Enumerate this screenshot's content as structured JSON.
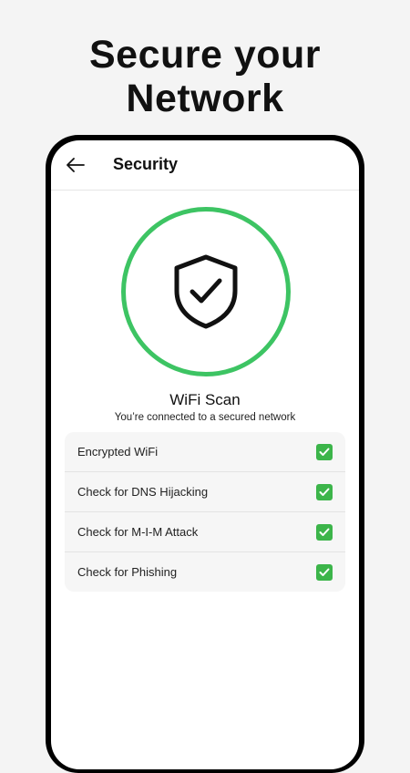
{
  "promo": {
    "title_line1": "Secure your",
    "title_line2": "Network"
  },
  "appbar": {
    "back_icon": "arrow-left-icon",
    "title": "Security"
  },
  "scan": {
    "status_icon": "shield-check-icon",
    "ring_color": "#3dc463",
    "title": "WiFi Scan",
    "subtitle": "You’re connected to a secured network"
  },
  "checks": [
    {
      "label": "Encrypted WiFi",
      "status": "checked"
    },
    {
      "label": "Check for DNS Hijacking",
      "status": "checked"
    },
    {
      "label": "Check for M-I-M Attack",
      "status": "checked"
    },
    {
      "label": "Check for Phishing",
      "status": "checked"
    }
  ],
  "colors": {
    "accent_green": "#3cb54a",
    "background": "#f4f4f4"
  }
}
